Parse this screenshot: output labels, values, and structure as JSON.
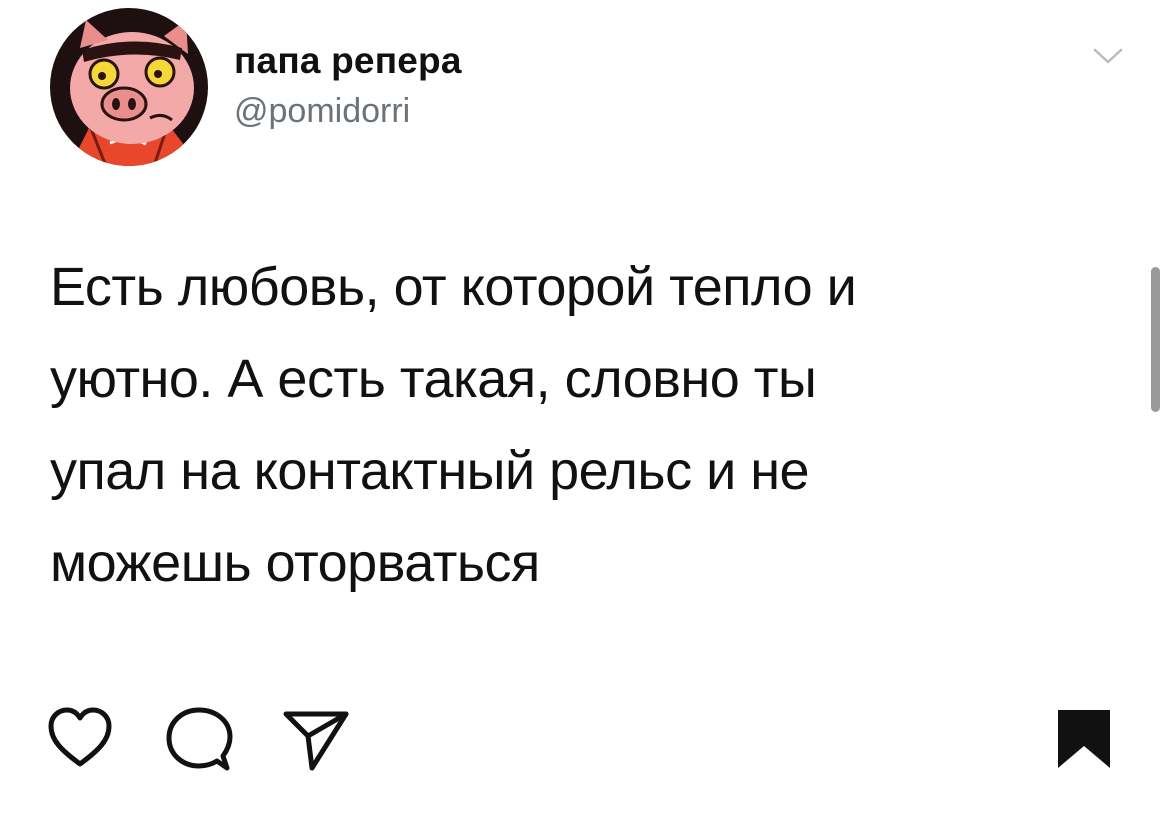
{
  "post": {
    "author": {
      "display_name": "папа репера",
      "handle": "@pomidorri",
      "avatar": "cartoon-pig-avatar"
    },
    "text_lines": [
      "Есть любовь, от которой тепло и",
      "уютно. А есть такая, словно ты",
      "упал на контактный рельс и не",
      "можешь оторваться"
    ]
  },
  "actions": {
    "icons": [
      "heart-icon",
      "comment-icon",
      "share-icon",
      "bookmark-icon"
    ]
  },
  "colors": {
    "text": "#111111",
    "handle": "#6b7278",
    "avatar_bg": "#1e1010",
    "pig_skin": "#f2a9a8",
    "shirt": "#e8472b",
    "eye": "#f5d73a"
  }
}
